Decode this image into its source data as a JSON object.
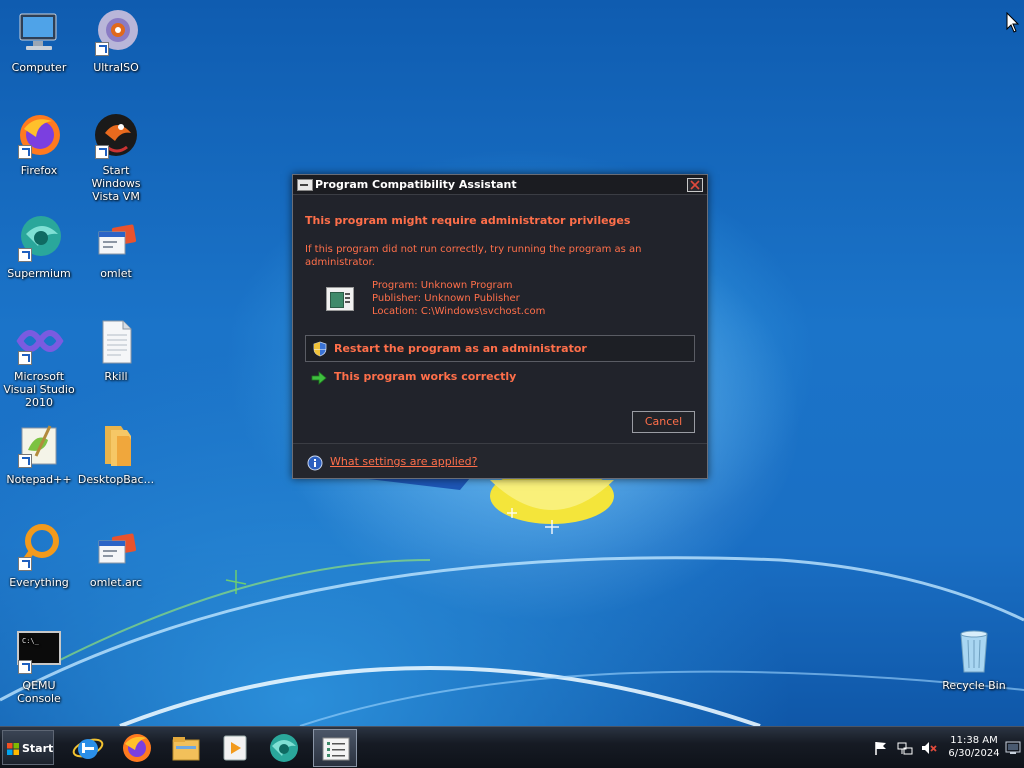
{
  "desktop": {
    "icons": [
      {
        "label": "Computer",
        "icon": "computer-icon"
      },
      {
        "label": "UltraISO",
        "icon": "ultraiso-icon"
      },
      {
        "label": "Firefox",
        "icon": "firefox-icon"
      },
      {
        "label": "Start Windows Vista VM",
        "icon": "vm-icon"
      },
      {
        "label": "Supermium",
        "icon": "supermium-icon"
      },
      {
        "label": "omlet",
        "icon": "omlet-icon"
      },
      {
        "label": "Microsoft Visual Studio 2010",
        "icon": "visual-studio-icon"
      },
      {
        "label": "Rkill",
        "icon": "text-file-icon"
      },
      {
        "label": "Notepad++",
        "icon": "notepadpp-icon"
      },
      {
        "label": "DesktopBac...",
        "icon": "folder-icon"
      },
      {
        "label": "Everything",
        "icon": "everything-icon"
      },
      {
        "label": "omlet.arc",
        "icon": "omlet-icon"
      },
      {
        "label": "QEMU Console",
        "icon": "console-icon"
      },
      {
        "label": "Recycle Bin",
        "icon": "recycle-bin-icon"
      }
    ]
  },
  "dialog": {
    "title": "Program Compatibility Assistant",
    "heading": "This program might require administrator privileges",
    "description": "If this program did not run correctly, try running the program as an administrator.",
    "program": "Program: Unknown Program",
    "publisher": "Publisher: Unknown Publisher",
    "location": "Location: C:\\Windows\\svchost.com",
    "option_admin": "Restart the program as an administrator",
    "option_works": "This program works correctly",
    "cancel_label": "Cancel",
    "settings_link": "What settings are applied?",
    "accent_color": "#ff6f4a"
  },
  "taskbar": {
    "start_label": "Start",
    "pinned": [
      {
        "icon": "internet-explorer-icon"
      },
      {
        "icon": "firefox-icon"
      },
      {
        "icon": "file-explorer-icon"
      },
      {
        "icon": "media-player-icon"
      },
      {
        "icon": "supermium-icon"
      },
      {
        "icon": "compatibility-assistant-icon"
      }
    ],
    "clock": {
      "time": "11:38 AM",
      "date": "6/30/2024"
    }
  }
}
